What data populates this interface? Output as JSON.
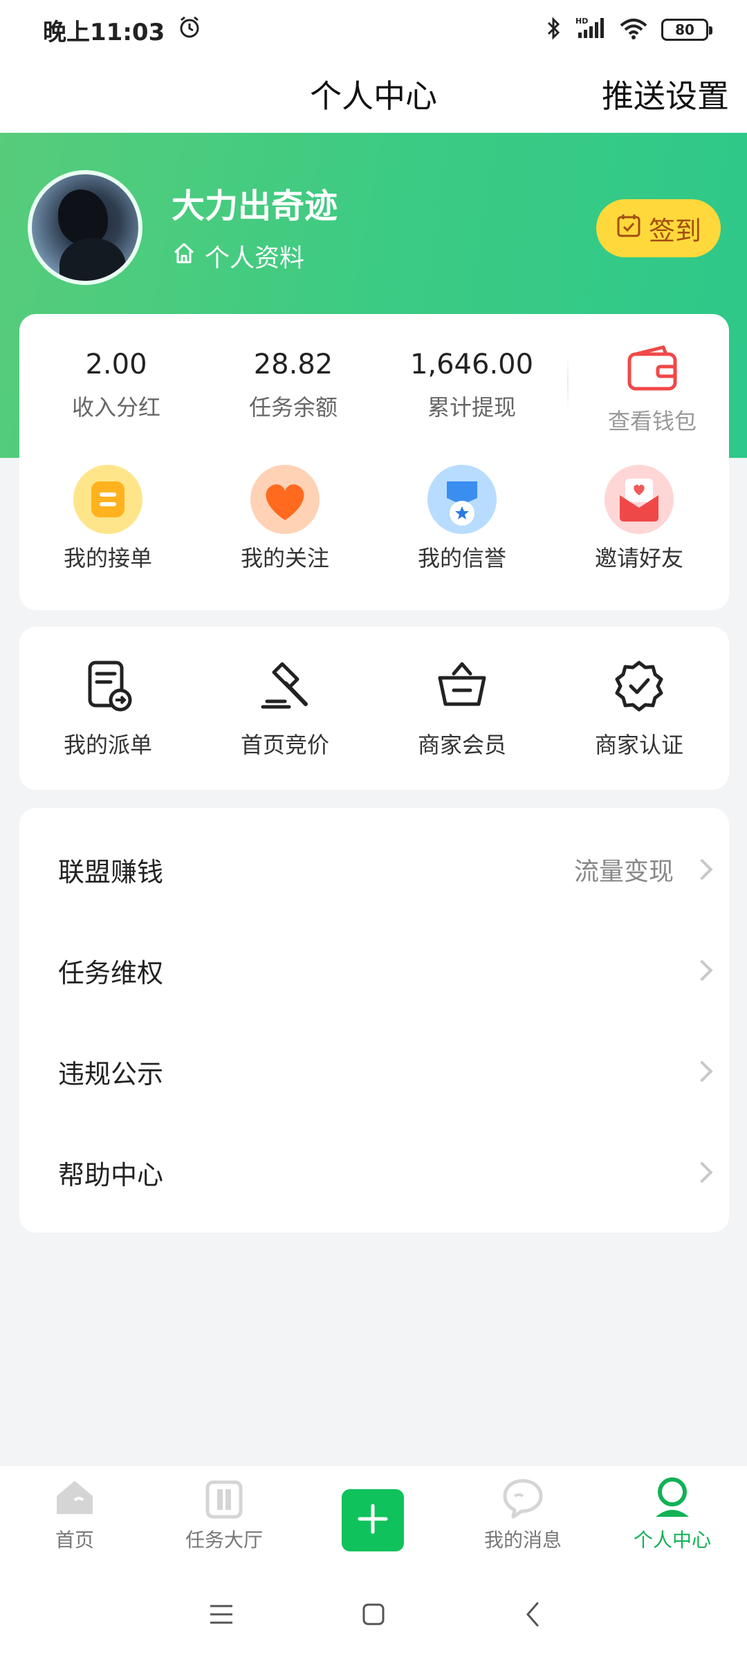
{
  "status_bar": {
    "time": "晚上11:03",
    "battery": "80",
    "hd": "HD"
  },
  "header": {
    "title": "个人中心",
    "push_settings": "推送设置"
  },
  "profile": {
    "username": "大力出奇迹",
    "profile_link": "个人资料",
    "checkin_label": "签到"
  },
  "stats": [
    {
      "value": "2.00",
      "label": "收入分红"
    },
    {
      "value": "28.82",
      "label": "任务余额"
    },
    {
      "value": "1,646.00",
      "label": "累计提现"
    }
  ],
  "wallet": {
    "label": "查看钱包"
  },
  "quick_actions": [
    {
      "label": "我的接单",
      "icon": "order-icon"
    },
    {
      "label": "我的关注",
      "icon": "heart-icon"
    },
    {
      "label": "我的信誉",
      "icon": "medal-icon"
    },
    {
      "label": "邀请好友",
      "icon": "invite-envelope-icon"
    }
  ],
  "merchant_tools": [
    {
      "label": "我的派单",
      "icon": "dispatch-doc-icon"
    },
    {
      "label": "首页竞价",
      "icon": "gavel-icon"
    },
    {
      "label": "商家会员",
      "icon": "crown-basket-icon"
    },
    {
      "label": "商家认证",
      "icon": "verified-badge-icon"
    }
  ],
  "menu": [
    {
      "label": "联盟赚钱",
      "sub": "流量变现"
    },
    {
      "label": "任务维权",
      "sub": ""
    },
    {
      "label": "违规公示",
      "sub": ""
    },
    {
      "label": "帮助中心",
      "sub": ""
    }
  ],
  "bottom_nav": [
    {
      "label": "首页",
      "icon": "home-icon"
    },
    {
      "label": "任务大厅",
      "icon": "task-hall-icon"
    },
    {
      "label": "",
      "icon": "plus-icon"
    },
    {
      "label": "我的消息",
      "icon": "message-icon"
    },
    {
      "label": "个人中心",
      "icon": "user-icon",
      "active": true
    }
  ],
  "colors": {
    "brand_green": "#2ec88a",
    "checkin_yellow": "#ffd93b",
    "active_nav": "#12b255",
    "wallet_red": "#f04848"
  }
}
